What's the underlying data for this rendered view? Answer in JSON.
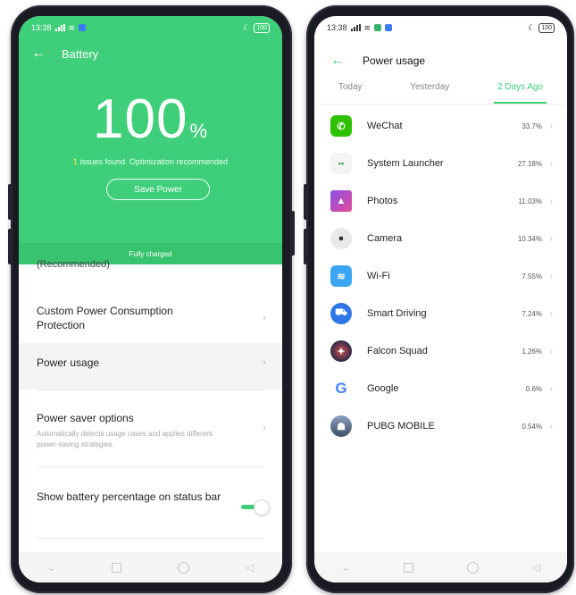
{
  "left_phone": {
    "status": {
      "time": "13:38",
      "battery": "100"
    },
    "header": {
      "back_icon": "arrow-left-icon",
      "title": "Battery"
    },
    "battery": {
      "percent": "100",
      "unit": "%"
    },
    "issues": {
      "count": "1",
      "text": " issues found. Optimization recommended"
    },
    "save_button": "Save Power",
    "charged_label": "Fully charged",
    "cut_off_text": "(Recommended)",
    "settings": {
      "custom_protection": "Custom Power Consumption Protection",
      "power_usage": "Power usage",
      "saver_title": "Power saver options",
      "saver_sub": "Automatically detects usage cases and applies different power-saving strategies.",
      "show_percentage": "Show battery percentage on status bar",
      "show_percentage_on": true
    }
  },
  "right_phone": {
    "status": {
      "time": "13:38",
      "battery": "100"
    },
    "header": {
      "back_icon": "arrow-left-icon",
      "title": "Power usage"
    },
    "tabs": [
      {
        "label": "Today",
        "active": false
      },
      {
        "label": "Yesterday",
        "active": false
      },
      {
        "label": "2 Days Ago",
        "active": true
      }
    ],
    "apps": [
      {
        "name": "WeChat",
        "percent": "33.7%",
        "icon": "wechat-icon",
        "color": "#2dc100"
      },
      {
        "name": "System Launcher",
        "percent": "27.18%",
        "icon": "launcher-icon",
        "color": "#f4f4f4"
      },
      {
        "name": "Photos",
        "percent": "11.03%",
        "icon": "photos-icon",
        "color": "#e64b9a"
      },
      {
        "name": "Camera",
        "percent": "10.34%",
        "icon": "camera-icon",
        "color": "#e9e9e9"
      },
      {
        "name": "Wi-Fi",
        "percent": "7.55%",
        "icon": "wifi-icon",
        "color": "#3aa6f3"
      },
      {
        "name": "Smart Driving",
        "percent": "7.24%",
        "icon": "car-icon",
        "color": "#2f76e8"
      },
      {
        "name": "Falcon Squad",
        "percent": "1.26%",
        "icon": "falcon-squad-icon",
        "color": "#2b2b4a"
      },
      {
        "name": "Google",
        "percent": "0.6%",
        "icon": "google-icon",
        "color": "#ffffff"
      },
      {
        "name": "PUBG MOBILE",
        "percent": "0.54%",
        "icon": "pubg-icon",
        "color": "#5a6f8a"
      }
    ]
  },
  "colors": {
    "accent": "#3fcf7a",
    "issue_number": "#ffe44d"
  }
}
